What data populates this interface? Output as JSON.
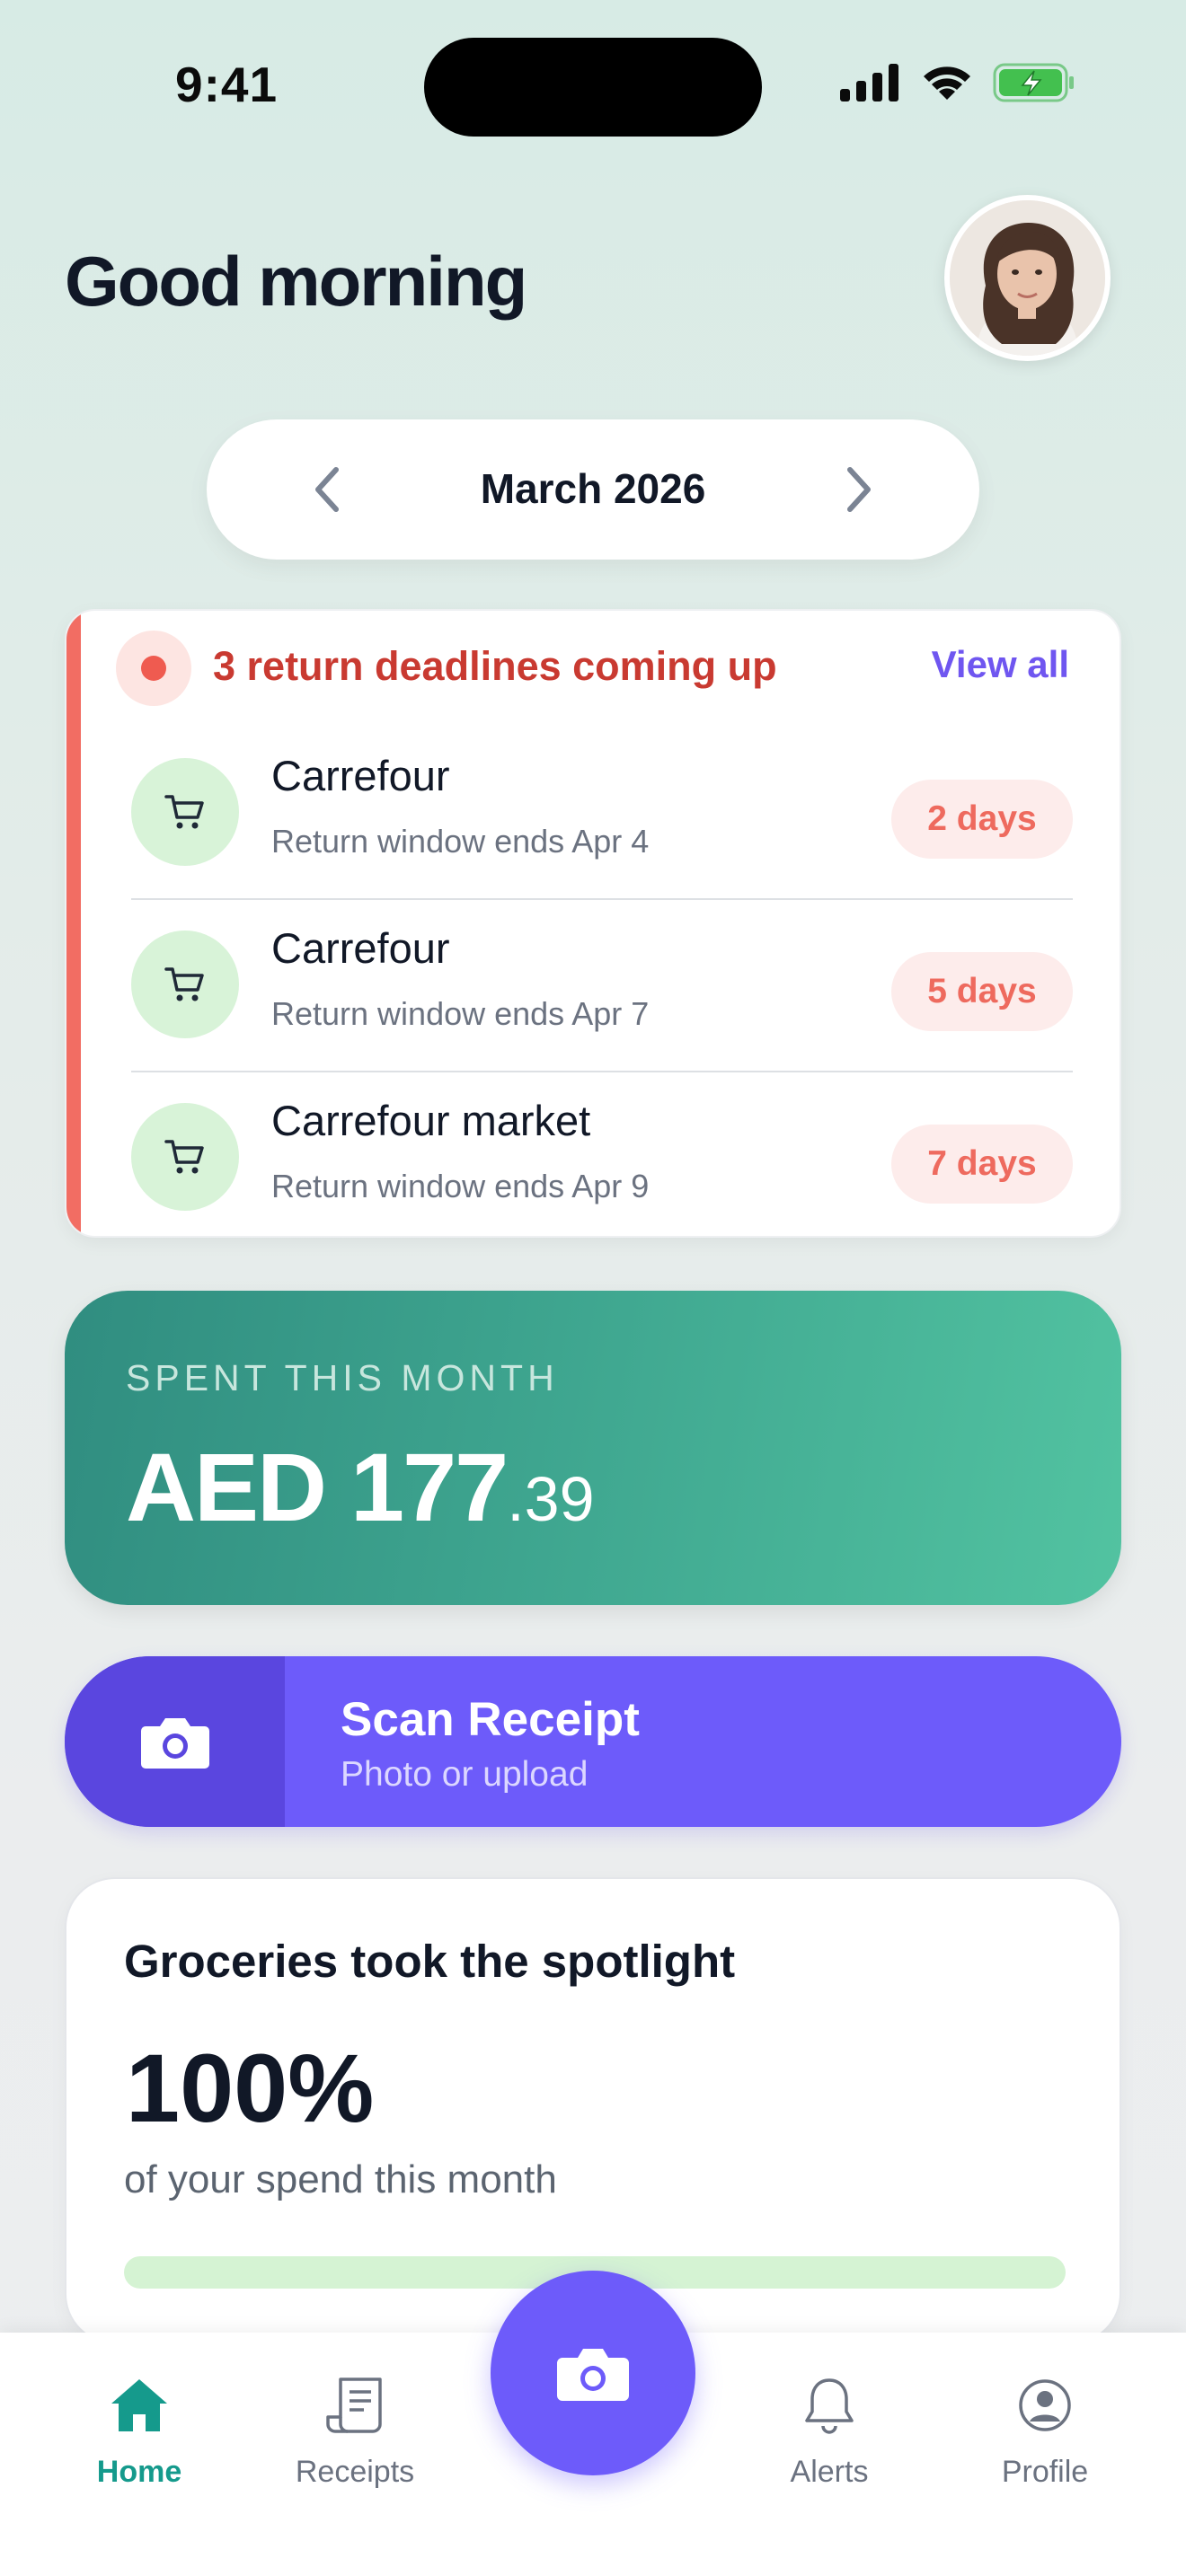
{
  "status_bar": {
    "time": "9:41"
  },
  "header": {
    "greeting": "Good morning"
  },
  "month_selector": {
    "label": "March 2026"
  },
  "deadlines": {
    "title": "3 return deadlines coming up",
    "view_all": "View all",
    "items": [
      {
        "store": "Carrefour",
        "subtitle": "Return window ends Apr 4",
        "days": "2 days"
      },
      {
        "store": "Carrefour",
        "subtitle": "Return window ends Apr 7",
        "days": "5 days"
      },
      {
        "store": "Carrefour market",
        "subtitle": "Return window ends Apr 9",
        "days": "7 days"
      }
    ]
  },
  "spent": {
    "label": "SPENT THIS MONTH",
    "amount_main": "AED 177",
    "amount_cents": ".39"
  },
  "scan": {
    "title": "Scan Receipt",
    "subtitle": "Photo or upload"
  },
  "spotlight": {
    "title": "Groceries took the spotlight",
    "percent": "100%",
    "subtitle": "of your spend this month",
    "progress": 1.0
  },
  "tabs": {
    "home": "Home",
    "receipts": "Receipts",
    "alerts": "Alerts",
    "profile": "Profile"
  },
  "icons": [
    "signal-icon",
    "wifi-icon",
    "battery-icon",
    "cart-icon",
    "camera-icon",
    "home-icon",
    "receipt-icon",
    "bell-icon",
    "profile-icon",
    "chevron-left-icon",
    "chevron-right-icon"
  ],
  "colors": {
    "accent": "#6d5bfa",
    "teal": "#3ea58f",
    "alert": "#ef5b50",
    "active_tab": "#159a8c"
  }
}
